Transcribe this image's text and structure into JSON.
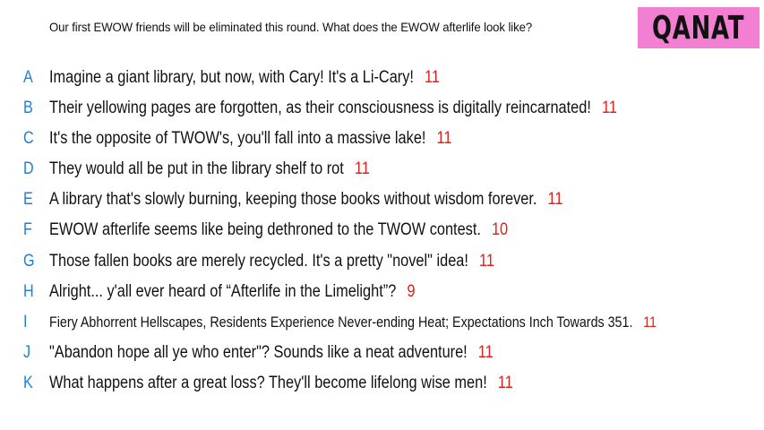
{
  "prompt": "Our first EWOW friends will be eliminated this round. What does the EWOW afterlife look like?",
  "contestant": "QANAT",
  "responses": [
    {
      "letter": "A",
      "text": "Imagine a giant library, but now, with Cary! It's a Li-Cary!",
      "count": "11"
    },
    {
      "letter": "B",
      "text": "Their yellowing pages are forgotten, as their consciousness is digitally reincarnated!",
      "count": "11"
    },
    {
      "letter": "C",
      "text": "It's the opposite of TWOW's, you'll fall into a massive lake!",
      "count": "11"
    },
    {
      "letter": "D",
      "text": "They would all be put in the library shelf to rot",
      "count": "11"
    },
    {
      "letter": "E",
      "text": "A library that's slowly burning, keeping those books without wisdom forever.",
      "count": "11"
    },
    {
      "letter": "F",
      "text": "EWOW afterlife seems like being dethroned to the TWOW contest.",
      "count": "10"
    },
    {
      "letter": "G",
      "text": "Those fallen books are merely recycled. It's a pretty \"novel\" idea!",
      "count": "11"
    },
    {
      "letter": "H",
      "text": "Alright... y'all ever heard of “Afterlife in the Limelight”?",
      "count": "9"
    },
    {
      "letter": "I",
      "text": "Fiery Abhorrent Hellscapes, Residents Experience Never-ending Heat; Expectations Inch Towards 351.",
      "count": "11"
    },
    {
      "letter": "J",
      "text": "\"Abandon hope all ye who enter\"? Sounds like a neat adventure!",
      "count": "11"
    },
    {
      "letter": "K",
      "text": "What happens after a great loss? They'll become lifelong wise men!",
      "count": "11"
    }
  ],
  "colors": {
    "letter": "#1f7fd8",
    "count": "#e0201a",
    "badge": "#f27fd2"
  }
}
